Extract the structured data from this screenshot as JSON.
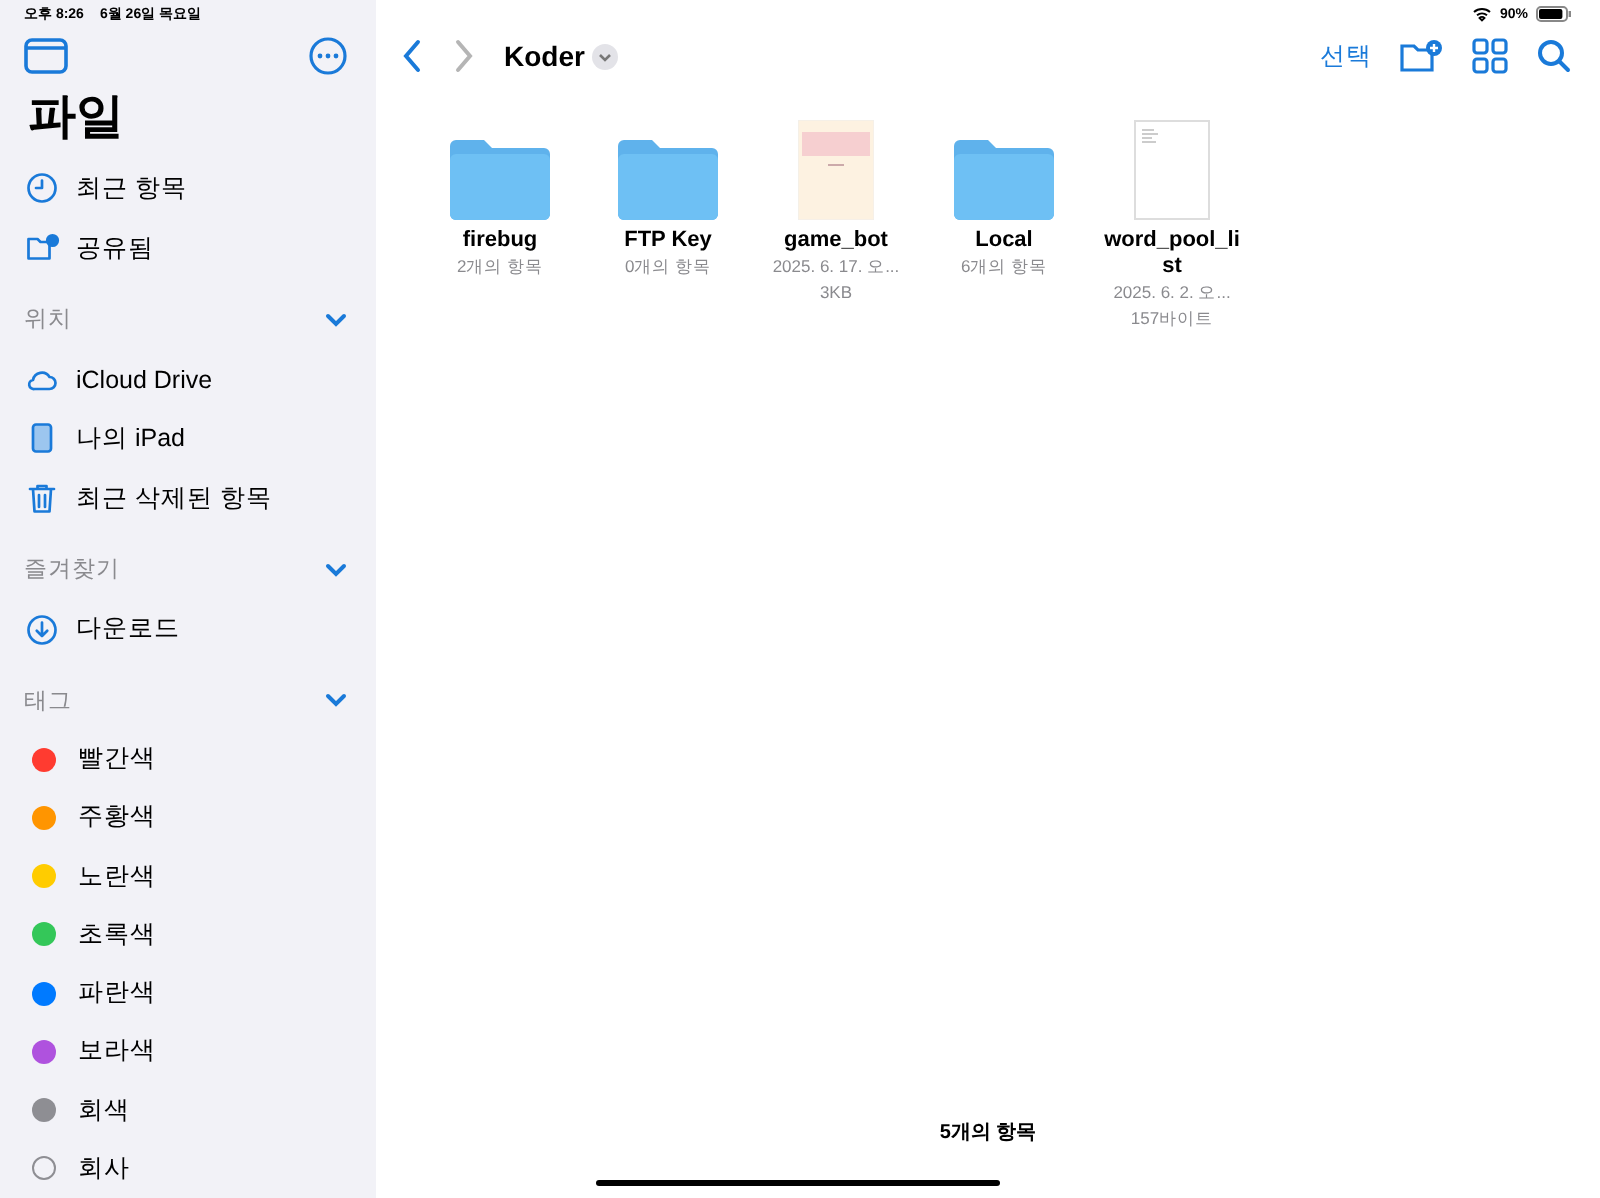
{
  "status_bar": {
    "time": "오후 8:26",
    "date": "6월 26일 목요일",
    "battery": "90%"
  },
  "sidebar": {
    "title": "파일",
    "items": [
      {
        "kind": "clock",
        "label": "최근 항목"
      },
      {
        "kind": "shared",
        "label": "공유됨"
      }
    ],
    "sections": [
      {
        "title": "위치",
        "expanded": true,
        "items": [
          {
            "kind": "cloud",
            "label": "iCloud Drive"
          },
          {
            "kind": "ipad",
            "label": "나의 iPad"
          },
          {
            "kind": "trash",
            "label": "최근 삭제된 항목"
          }
        ]
      },
      {
        "title": "즐겨찾기",
        "expanded": true,
        "items": [
          {
            "kind": "download",
            "label": "다운로드"
          }
        ]
      },
      {
        "title": "태그",
        "expanded": true,
        "items": [
          {
            "kind": "tag",
            "label": "빨간색",
            "color": "#ff3b30"
          },
          {
            "kind": "tag",
            "label": "주황색",
            "color": "#ff9500"
          },
          {
            "kind": "tag",
            "label": "노란색",
            "color": "#ffcc00"
          },
          {
            "kind": "tag",
            "label": "초록색",
            "color": "#34c759"
          },
          {
            "kind": "tag",
            "label": "파란색",
            "color": "#007aff"
          },
          {
            "kind": "tag",
            "label": "보라색",
            "color": "#af52de"
          },
          {
            "kind": "tag",
            "label": "회색",
            "color": "#8e8e93"
          },
          {
            "kind": "untagged",
            "label": "회사"
          }
        ]
      }
    ]
  },
  "toolbar": {
    "title": "Koder",
    "select": "선택"
  },
  "files": [
    {
      "kind": "folder",
      "name": "firebug",
      "details": [
        "2개의 항목"
      ]
    },
    {
      "kind": "folder",
      "name": "FTP Key",
      "details": [
        "0개의 항목"
      ]
    },
    {
      "kind": "preview",
      "name": "game_bot",
      "details": [
        "2025. 6. 17. 오...",
        "3KB"
      ]
    },
    {
      "kind": "folder",
      "name": "Local",
      "details": [
        "6개의 항목"
      ]
    },
    {
      "kind": "document",
      "name": "word_pool_list",
      "details": [
        "2025. 6. 2. 오...",
        "157바이트"
      ]
    }
  ],
  "footer": "5개의 항목"
}
